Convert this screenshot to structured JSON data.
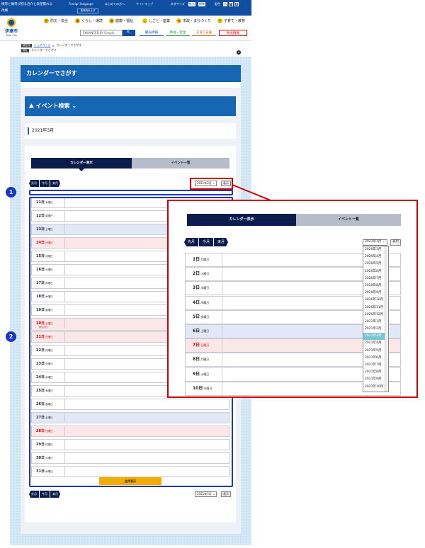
{
  "topbar": {
    "text1": "携帯と傷帯が割る沼介と表望揚れる",
    "text2": "改構",
    "links": [
      "Foreign language",
      "はじめての方へ",
      "サイトマップ"
    ],
    "fontsize_label": "文字サイズ",
    "enlarge": "拡大",
    "standard": "標準",
    "bgcolor_label": "配色",
    "white": "白",
    "black": "黒",
    "blue": "青",
    "sub_btn": "音声読み上げ"
  },
  "header": {
    "logo_city": "伊達市",
    "logo_en": "Date City",
    "nav": [
      {
        "icon": "防",
        "label": "防災・安全"
      },
      {
        "icon": "暮",
        "label": "くらし・環境"
      },
      {
        "icon": "健",
        "label": "健康・福祉"
      },
      {
        "icon": "し",
        "label": "しごと・産業"
      },
      {
        "icon": "市",
        "label": "市政・まちづくり"
      },
      {
        "icon": "子",
        "label": "子育て・教育"
      }
    ],
    "search_placeholder": "ENHANCED BY Google",
    "search_btn": "🔍",
    "quick": [
      "観光情報",
      "移住・定住",
      "子育て支援",
      "防災情報"
    ]
  },
  "breadcrumb": {
    "tag1": "現在地",
    "home": "トップページ",
    "current": "カレンダーでさがす",
    "tag2": "現在",
    "current2": "カレンダーでさがす"
  },
  "page_title": "カレンダーでさがす",
  "event_search": "イベント検索",
  "month": "2021年3月",
  "tabs": {
    "calendar": "カレンダー表示",
    "list": "イベント一覧"
  },
  "nav": {
    "prev": "先月",
    "today": "今月",
    "next": "来月"
  },
  "select": {
    "value": "2021年3月 ⌄",
    "display": "表示"
  },
  "rows": [
    {
      "label": "11日",
      "dow": "木曜日",
      "type": "wd"
    },
    {
      "label": "12日",
      "dow": "金曜日",
      "type": "wd"
    },
    {
      "label": "13日",
      "dow": "土曜日",
      "type": "sat"
    },
    {
      "label": "14日",
      "dow": "日曜日",
      "type": "sun"
    },
    {
      "label": "15日",
      "dow": "月曜日",
      "type": "wd"
    },
    {
      "label": "16日",
      "dow": "火曜日",
      "type": "wd"
    },
    {
      "label": "17日",
      "dow": "水曜日",
      "type": "wd"
    },
    {
      "label": "18日",
      "dow": "木曜日",
      "type": "wd"
    },
    {
      "label": "19日",
      "dow": "金曜日",
      "type": "wd"
    },
    {
      "label": "20日",
      "dow": "土曜日",
      "type": "sun",
      "note": "春分の日"
    },
    {
      "label": "21日",
      "dow": "日曜日",
      "type": "sun"
    },
    {
      "label": "22日",
      "dow": "月曜日",
      "type": "wd"
    },
    {
      "label": "23日",
      "dow": "火曜日",
      "type": "wd"
    },
    {
      "label": "24日",
      "dow": "水曜日",
      "type": "wd"
    },
    {
      "label": "25日",
      "dow": "木曜日",
      "type": "wd"
    },
    {
      "label": "26日",
      "dow": "金曜日",
      "type": "wd"
    },
    {
      "label": "27日",
      "dow": "土曜日",
      "type": "sat"
    },
    {
      "label": "28日",
      "dow": "日曜日",
      "type": "sun"
    },
    {
      "label": "29日",
      "dow": "月曜日",
      "type": "wd"
    },
    {
      "label": "30日",
      "dow": "火曜日",
      "type": "wd"
    },
    {
      "label": "31日",
      "dow": "水曜日",
      "type": "wd"
    }
  ],
  "all_btn": "全件表示",
  "badges": [
    "1",
    "2"
  ],
  "zoom": {
    "rows": [
      {
        "label": "1日",
        "dow": "月曜日",
        "type": "wd"
      },
      {
        "label": "2日",
        "dow": "火曜日",
        "type": "wd"
      },
      {
        "label": "3日",
        "dow": "水曜日",
        "type": "wd"
      },
      {
        "label": "4日",
        "dow": "木曜日",
        "type": "wd"
      },
      {
        "label": "5日",
        "dow": "金曜日",
        "type": "wd"
      },
      {
        "label": "6日",
        "dow": "土曜日",
        "type": "sat"
      },
      {
        "label": "7日",
        "dow": "日曜日",
        "type": "sun"
      },
      {
        "label": "8日",
        "dow": "月曜日",
        "type": "wd"
      },
      {
        "label": "9日",
        "dow": "火曜日",
        "type": "wd"
      },
      {
        "label": "10日",
        "dow": "水曜日",
        "type": "wd"
      }
    ],
    "options": [
      "2020年3月",
      "2020年4月",
      "2020年5月",
      "2020年6月",
      "2020年7月",
      "2020年8月",
      "2020年9月",
      "2020年10月",
      "2020年11月",
      "2020年12月",
      "2021年1月",
      "2021年2月",
      "2021年3月",
      "2021年4月",
      "2021年5月",
      "2021年6月",
      "2021年7月",
      "2021年8月",
      "2021年9月",
      "2021年10月"
    ],
    "active_index": 12
  },
  "colors": {
    "primary": "#1766b3",
    "navy": "#0b1d4d",
    "highlight": "#1636c9",
    "callout": "#d40000",
    "sunday": "#d00000",
    "saturday_bg": "#e3e8f7",
    "sunday_bg": "#fbe7e7",
    "accent": "#f2ae00"
  }
}
